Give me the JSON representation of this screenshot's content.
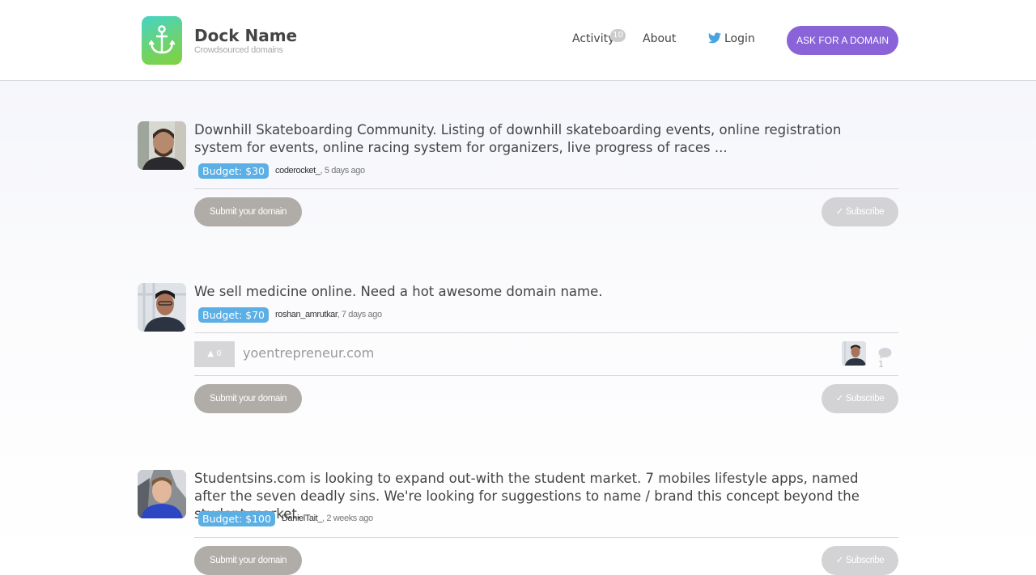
{
  "header": {
    "brand_name": "Dock Name",
    "brand_tagline": "Crowdsourced domains",
    "nav": {
      "activity_label": "Activity",
      "activity_badge": "10",
      "about_label": "About",
      "login_label": "Login"
    },
    "ask_button_label": "ASK FOR A DOMAIN"
  },
  "posts": [
    {
      "text": "Downhill Skateboarding Community. Listing of downhill skateboarding events, online registration system for events, online racing system for organizers, live progress of races ...",
      "budget": "Budget: $30",
      "user": "coderocket_",
      "time": ", 5 days ago",
      "submit_label": "Submit your domain",
      "subscribe_label": "✓ Subscribe"
    },
    {
      "text": "We sell medicine online. Need a hot awesome domain name.",
      "budget": "Budget: $70",
      "user": "roshan_amrutkar",
      "time": ", 7 days ago",
      "suggestion": {
        "votes": "▲ 0",
        "domain": "yoentrepreneur.com",
        "comments": "1"
      },
      "submit_label": "Submit your domain",
      "subscribe_label": "✓ Subscribe"
    },
    {
      "text": "Studentsins.com is looking to expand out-with the student market. 7 mobiles lifestyle apps, named after the seven deadly sins. We're looking for suggestions to name / brand this concept beyond the student market.",
      "budget": "Budget: $100",
      "user": "DanielTait_",
      "time": ", 2 weeks ago",
      "submit_label": "Submit your domain",
      "subscribe_label": "✓ Subscribe"
    }
  ],
  "colors": {
    "accent_purple": "#8a63d9",
    "budget_blue": "#5bafe4",
    "logo_green": "#7fd23f",
    "logo_teal": "#45d3c7"
  },
  "icons": [
    "anchor-icon",
    "twitter-bird-icon",
    "comment-bubble-icon"
  ]
}
